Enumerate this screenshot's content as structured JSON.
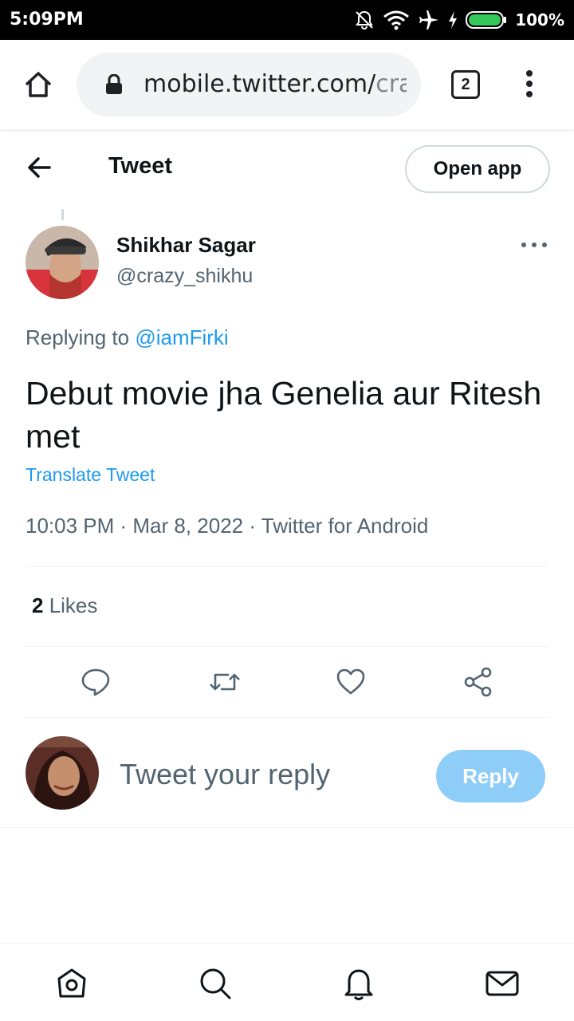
{
  "status_bar": {
    "time": "5:09PM",
    "battery": "100%",
    "icons": [
      "mute-icon",
      "wifi-icon",
      "airplane-icon",
      "charging-icon",
      "battery-icon"
    ]
  },
  "browser": {
    "url_host": "mobile.twitter.com/",
    "url_rest": "crazy_shikhu",
    "tab_count": "2"
  },
  "header": {
    "title": "Tweet",
    "open_app_label": "Open app"
  },
  "tweet": {
    "author_name": "Shikhar Sagar",
    "author_handle": "@crazy_shikhu",
    "replying_prefix": "Replying to ",
    "replying_to": "@iamFirki",
    "text": "Debut movie jha Genelia aur Ritesh met",
    "translate_label": "Translate Tweet",
    "meta": "10:03 PM · Mar 8, 2022 · Twitter for Android",
    "likes_count": "2",
    "likes_label": " Likes"
  },
  "reply": {
    "placeholder": "Tweet your reply",
    "button_label": "Reply"
  },
  "colors": {
    "accent": "#1d9bf0",
    "reply_button": "#8ecdf8",
    "secondary_text": "#536471"
  }
}
